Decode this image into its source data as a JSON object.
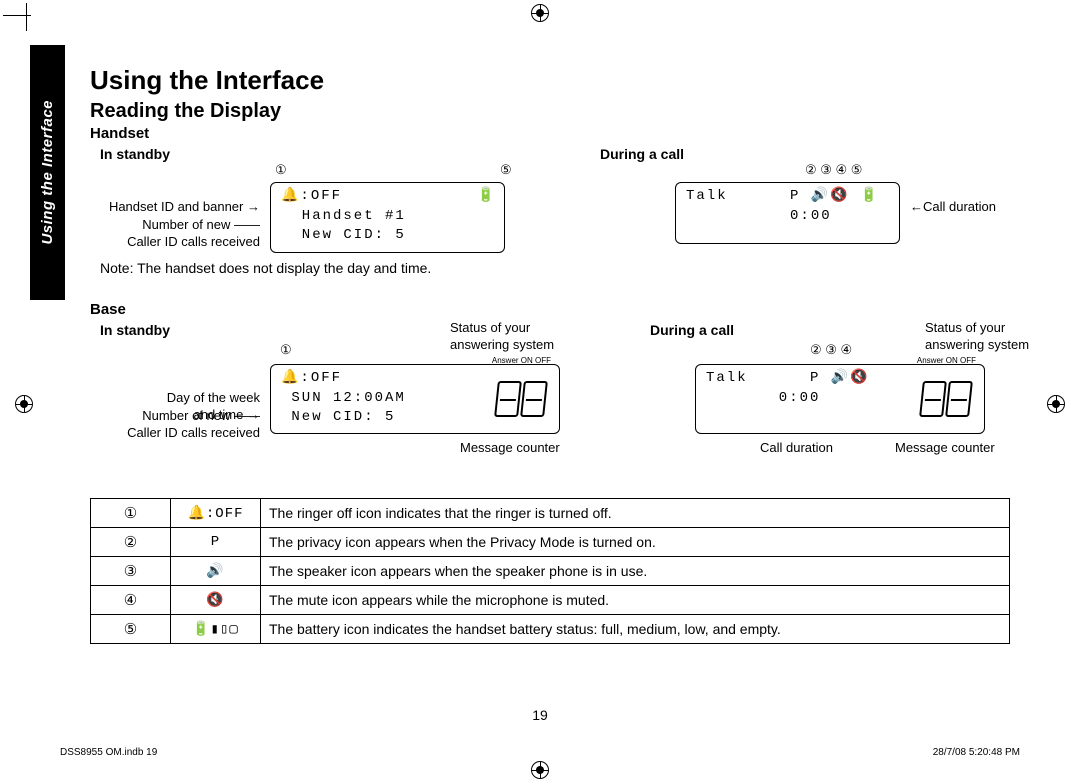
{
  "side_tab": "Using the Interface",
  "h1": "Using the Interface",
  "h2": "Reading the Display",
  "handset": {
    "heading": "Handset",
    "standby": {
      "heading": "In standby",
      "markers_left": "①",
      "markers_right": "⑤",
      "lcd_line1": "🔔:OFF             🔋",
      "lcd_line2": "  Handset #1",
      "lcd_line3": "  New CID: 5",
      "callout1": "Handset ID and banner",
      "callout2": "Number of new",
      "callout3": "Caller ID calls received"
    },
    "during": {
      "heading": "During a call",
      "markers": "②  ③ ④ ⑤",
      "lcd_line1": "Talk      P 🔊🔇 🔋",
      "lcd_line2": "          0:00",
      "callout": "Call duration"
    },
    "note": "Note: The handset does not display the day and time."
  },
  "base": {
    "heading": "Base",
    "standby": {
      "heading": "In standby",
      "marker": "①",
      "status_label": "Status of your\nanswering system",
      "answer_label": "Answer ON OFF",
      "lcd_line1": "🔔:OFF",
      "lcd_line2": " SUN 12:00AM",
      "lcd_line3": " New CID: 5",
      "callout1": "Day of the week\nand time",
      "callout2": "Number of new",
      "callout3": "Caller ID calls received",
      "counter_label": "Message counter"
    },
    "during": {
      "heading": "During a call",
      "markers": "②  ③ ④",
      "status_label": "Status of your\nanswering system",
      "answer_label": "Answer ON OFF",
      "lcd_line1": "Talk      P 🔊🔇",
      "lcd_line2": "       0:00",
      "callout_dur": "Call duration",
      "counter_label": "Message counter"
    }
  },
  "legend": [
    {
      "num": "①",
      "icon": "🔔:OFF",
      "desc": "The ringer off icon indicates that the ringer is turned off."
    },
    {
      "num": "②",
      "icon": "P",
      "desc": "The privacy icon appears when the Privacy Mode is turned on."
    },
    {
      "num": "③",
      "icon": "🔊",
      "desc": "The speaker icon appears when the speaker phone is in use."
    },
    {
      "num": "④",
      "icon": "🔇",
      "desc": "The mute icon appears while the microphone is muted."
    },
    {
      "num": "⑤",
      "icon": "🔋▮▯▢",
      "desc": "The battery icon indicates the handset battery status: full, medium, low, and empty."
    }
  ],
  "page_number": "19",
  "footer_left": "DSS8955 OM.indb   19",
  "footer_right": "28/7/08   5:20:48 PM"
}
